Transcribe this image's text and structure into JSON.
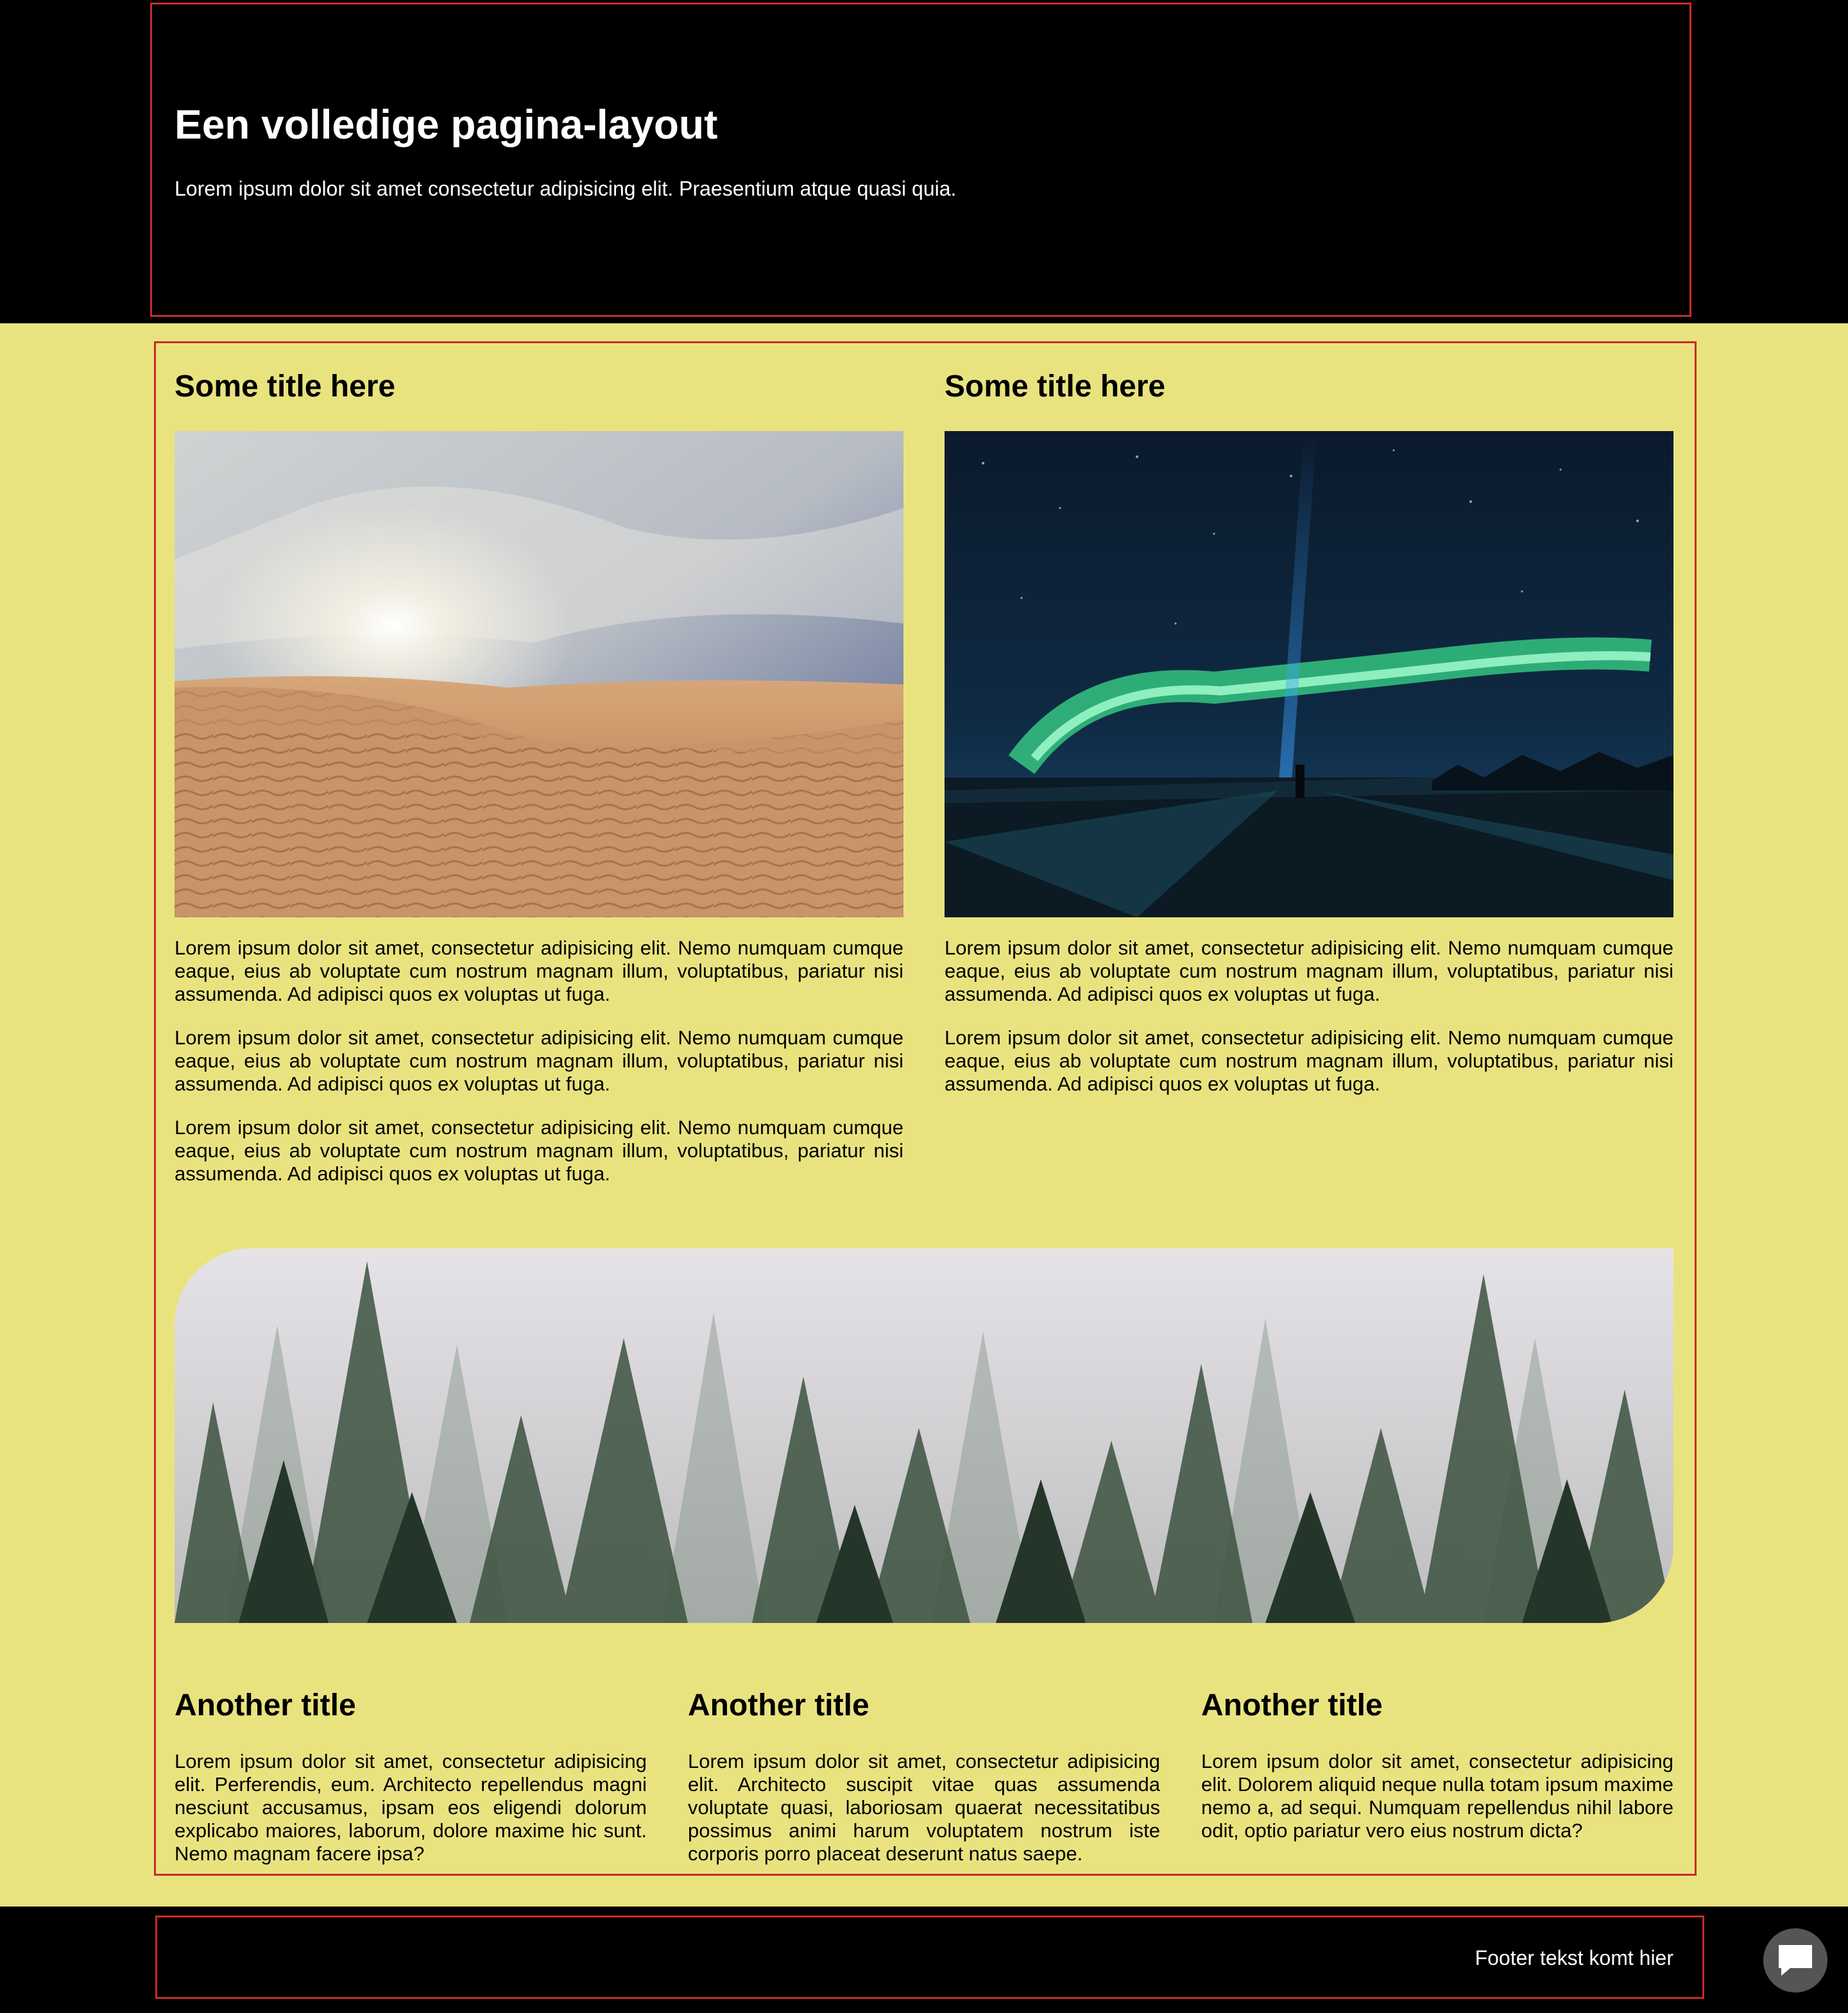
{
  "header": {
    "title": "Een volledige pagina-layout",
    "subtitle": "Lorem ipsum dolor sit amet consectetur adipisicing elit. Praesentium atque quasi quia."
  },
  "columns": [
    {
      "title": "Some title here",
      "image_icon": "desert-dunes-photo",
      "paragraphs": [
        "Lorem ipsum dolor sit amet, consectetur adipisicing elit. Nemo numquam cumque eaque, eius ab voluptate cum nostrum magnam illum, voluptatibus, pariatur nisi assumenda. Ad adipisci quos ex voluptas ut fuga.",
        "Lorem ipsum dolor sit amet, consectetur adipisicing elit. Nemo numquam cumque eaque, eius ab voluptate cum nostrum magnam illum, voluptatibus, pariatur nisi assumenda. Ad adipisci quos ex voluptas ut fuga.",
        "Lorem ipsum dolor sit amet, consectetur adipisicing elit. Nemo numquam cumque eaque, eius ab voluptate cum nostrum magnam illum, voluptatibus, pariatur nisi assumenda. Ad adipisci quos ex voluptas ut fuga."
      ]
    },
    {
      "title": "Some title here",
      "image_icon": "aurora-night-photo",
      "paragraphs": [
        "Lorem ipsum dolor sit amet, consectetur adipisicing elit. Nemo numquam cumque eaque, eius ab voluptate cum nostrum magnam illum, voluptatibus, pariatur nisi assumenda. Ad adipisci quos ex voluptas ut fuga.",
        "Lorem ipsum dolor sit amet, consectetur adipisicing elit. Nemo numquam cumque eaque, eius ab voluptate cum nostrum magnam illum, voluptatibus, pariatur nisi assumenda. Ad adipisci quos ex voluptas ut fuga."
      ]
    }
  ],
  "banner": {
    "image_icon": "misty-forest-photo"
  },
  "cards": [
    {
      "title": "Another title",
      "text": "Lorem ipsum dolor sit amet, consectetur adipisicing elit. Perferendis, eum. Architecto repellendus magni nesciunt accusamus, ipsam eos eligendi dolorum explicabo maiores, laborum, dolore maxime hic sunt. Nemo magnam facere ipsa?"
    },
    {
      "title": "Another title",
      "text": "Lorem ipsum dolor sit amet, consectetur adipisicing elit. Architecto suscipit vitae quas assumenda voluptate quasi, laboriosam quaerat necessitatibus possimus animi harum voluptatem nostrum iste corporis porro placeat deserunt natus saepe."
    },
    {
      "title": "Another title",
      "text": "Lorem ipsum dolor sit amet, consectetur adipisicing elit. Dolorem aliquid neque nulla totam ipsum maxime nemo a, ad sequi. Numquam repellendus nihil labore odit, optio pariatur vero eius nostrum dicta?"
    }
  ],
  "footer": {
    "text": "Footer tekst komt hier"
  },
  "chat_button": {
    "icon": "chat-bubble-icon"
  },
  "colors": {
    "page_background": "#e9e37f",
    "header_footer_background": "#000000",
    "frame_border": "#c62b2b"
  }
}
